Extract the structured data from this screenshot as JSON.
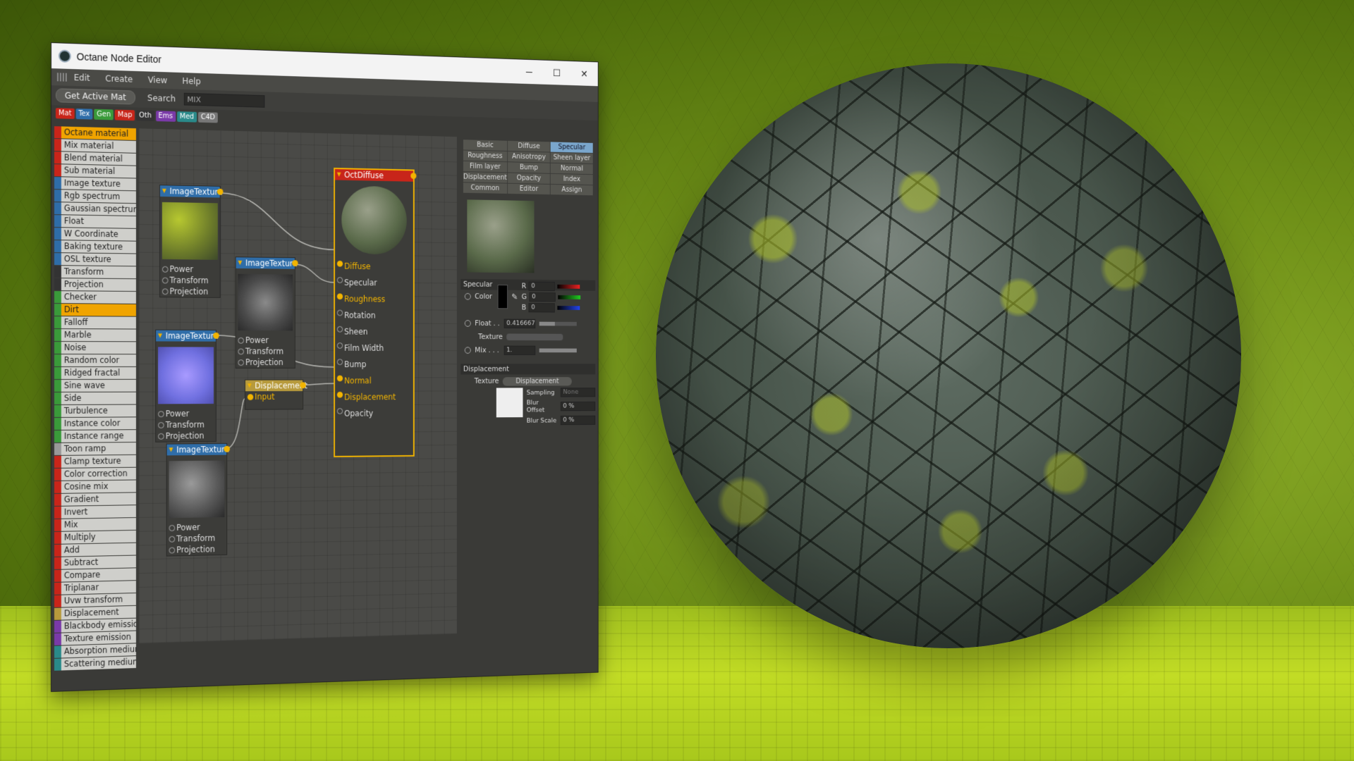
{
  "window": {
    "title": "Octane Node Editor",
    "menu": [
      "Edit",
      "Create",
      "View",
      "Help"
    ],
    "controls": {
      "minimize": "─",
      "maximize": "☐",
      "close": "✕"
    }
  },
  "toolbar": {
    "get_active_mat": "Get Active Mat",
    "search_label": "Search",
    "search_value": "MIX"
  },
  "categories": [
    {
      "label": "Mat",
      "color": "#c8251a"
    },
    {
      "label": "Tex",
      "color": "#2f6da8"
    },
    {
      "label": "Gen",
      "color": "#3a9a3a"
    },
    {
      "label": "Map",
      "color": "#c8251a"
    },
    {
      "label": "Oth",
      "color": "#333333"
    },
    {
      "label": "Ems",
      "color": "#7a3aa8"
    },
    {
      "label": "Med",
      "color": "#2a8a8a"
    },
    {
      "label": "C4D",
      "color": "#777777"
    }
  ],
  "node_list": [
    {
      "label": "Octane material",
      "color": "#c8251a",
      "selected": true
    },
    {
      "label": "Mix material",
      "color": "#c8251a"
    },
    {
      "label": "Blend material",
      "color": "#c8251a"
    },
    {
      "label": "Sub material",
      "color": "#c8251a"
    },
    {
      "label": "Image texture",
      "color": "#2f6da8"
    },
    {
      "label": "Rgb spectrum",
      "color": "#2f6da8"
    },
    {
      "label": "Gaussian spectrum",
      "color": "#2f6da8"
    },
    {
      "label": "Float",
      "color": "#2f6da8"
    },
    {
      "label": "W Coordinate",
      "color": "#2f6da8"
    },
    {
      "label": "Baking texture",
      "color": "#2f6da8"
    },
    {
      "label": "OSL texture",
      "color": "#2f6da8"
    },
    {
      "label": "Transform",
      "color": "#333333"
    },
    {
      "label": "Projection",
      "color": "#333333"
    },
    {
      "label": "Checker",
      "color": "#3a9a3a"
    },
    {
      "label": "Dirt",
      "color": "#3a9a3a",
      "selected": true
    },
    {
      "label": "Falloff",
      "color": "#3a9a3a"
    },
    {
      "label": "Marble",
      "color": "#3a9a3a"
    },
    {
      "label": "Noise",
      "color": "#3a9a3a"
    },
    {
      "label": "Random color",
      "color": "#3a9a3a"
    },
    {
      "label": "Ridged fractal",
      "color": "#3a9a3a"
    },
    {
      "label": "Sine wave",
      "color": "#3a9a3a"
    },
    {
      "label": "Side",
      "color": "#3a9a3a"
    },
    {
      "label": "Turbulence",
      "color": "#3a9a3a"
    },
    {
      "label": "Instance color",
      "color": "#3a9a3a"
    },
    {
      "label": "Instance range",
      "color": "#3a9a3a"
    },
    {
      "label": "Toon ramp",
      "color": "#999999"
    },
    {
      "label": "Clamp texture",
      "color": "#c8251a"
    },
    {
      "label": "Color correction",
      "color": "#c8251a"
    },
    {
      "label": "Cosine mix",
      "color": "#c8251a"
    },
    {
      "label": "Gradient",
      "color": "#c8251a"
    },
    {
      "label": "Invert",
      "color": "#c8251a"
    },
    {
      "label": "Mix",
      "color": "#c8251a"
    },
    {
      "label": "Multiply",
      "color": "#c8251a"
    },
    {
      "label": "Add",
      "color": "#c8251a"
    },
    {
      "label": "Subtract",
      "color": "#c8251a"
    },
    {
      "label": "Compare",
      "color": "#c8251a"
    },
    {
      "label": "Triplanar",
      "color": "#c8251a"
    },
    {
      "label": "Uvw transform",
      "color": "#c8251a"
    },
    {
      "label": "Displacement",
      "color": "#b79a3c"
    },
    {
      "label": "Blackbody emission",
      "color": "#7a3aa8"
    },
    {
      "label": "Texture emission",
      "color": "#7a3aa8"
    },
    {
      "label": "Absorption medium",
      "color": "#2a8a8a"
    },
    {
      "label": "Scattering medium",
      "color": "#2a8a8a"
    }
  ],
  "nodes": {
    "tex1": {
      "title": "ImageTexture",
      "ports": [
        "Power",
        "Transform",
        "Projection"
      ]
    },
    "tex2": {
      "title": "ImageTexture",
      "ports": [
        "Power",
        "Transform",
        "Projection"
      ]
    },
    "tex3": {
      "title": "ImageTexture",
      "ports": [
        "Power",
        "Transform",
        "Projection"
      ]
    },
    "tex4": {
      "title": "ImageTexture",
      "ports": [
        "Power",
        "Transform",
        "Projection"
      ]
    },
    "displacement": {
      "title": "Displacement",
      "ports": [
        "Input"
      ]
    },
    "main": {
      "title": "OctDiffuse",
      "ports": [
        "Diffuse",
        "Specular",
        "Roughness",
        "Rotation",
        "Sheen",
        "Film Width",
        "Bump",
        "Normal",
        "Displacement",
        "Opacity"
      ]
    }
  },
  "props": {
    "tabs": [
      "Basic",
      "Diffuse",
      "Specular",
      "Roughness",
      "Anisotropy",
      "Sheen layer",
      "Film layer",
      "Bump",
      "Normal",
      "Displacement",
      "Opacity",
      "Index",
      "Common",
      "Editor",
      "Assign"
    ],
    "active_tab": "Specular",
    "specular": {
      "section": "Specular",
      "color_label": "Color",
      "r_label": "R",
      "r_value": "0",
      "g_label": "G",
      "g_value": "0",
      "b_label": "B",
      "b_value": "0",
      "float_label": "Float . .",
      "float_value": "0.416667",
      "texture_label": "Texture",
      "mix_label": "Mix . . .",
      "mix_value": "1."
    },
    "displacement": {
      "section": "Displacement",
      "texture_label": "Texture",
      "texture_value": "Displacement",
      "sampling_label": "Sampling",
      "sampling_value": "None",
      "blur_offset_label": "Blur Offset",
      "blur_offset_value": "0 %",
      "blur_scale_label": "Blur Scale",
      "blur_scale_value": "0 %"
    }
  }
}
